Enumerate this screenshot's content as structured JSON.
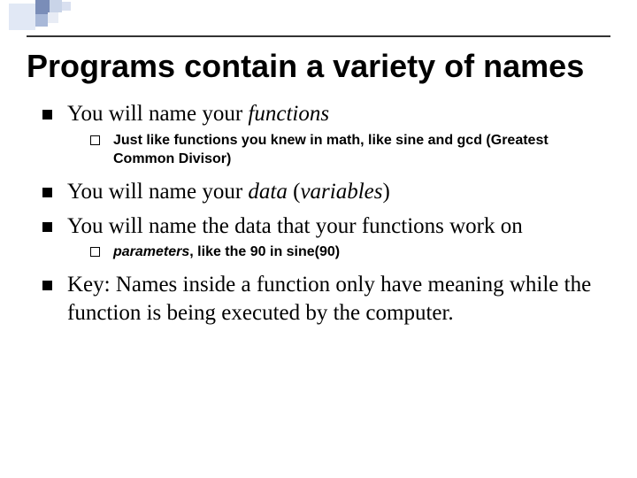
{
  "slide": {
    "title": "Programs contain a variety of names",
    "b1_pre": "You will name your ",
    "b1_ital": "functions",
    "b1_sub": "Just like functions you knew in math, like sine and gcd (Greatest Common Divisor)",
    "b2_pre": "You will name your ",
    "b2_ital": "data",
    "b2_post": " (",
    "b2_ital2": "variables",
    "b2_post2": ")",
    "b3": "You will name the data that your functions work on",
    "b3_sub_ital": "parameters",
    "b3_sub_rest": ", like the 90 in sine(90)",
    "b4": "Key: Names inside a function only have meaning while the function is being executed by the computer."
  }
}
